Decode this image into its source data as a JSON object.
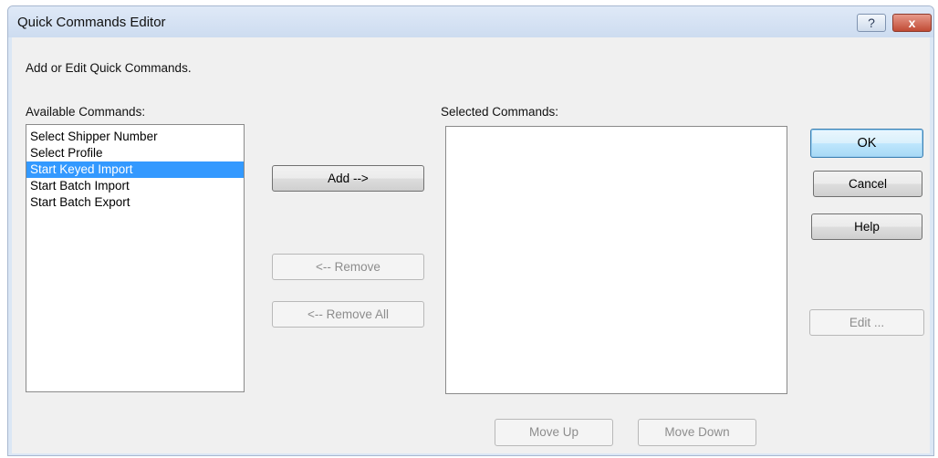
{
  "window": {
    "title": "Quick Commands Editor",
    "help_label": "?",
    "close_label": "x"
  },
  "instructions": "Add or Edit Quick Commands.",
  "available": {
    "label": "Available Commands:",
    "items": [
      "Select Shipper Number",
      "Select Profile",
      "Start Keyed Import",
      "Start Batch Import",
      "Start Batch Export"
    ],
    "selected_item": "Start Keyed Import"
  },
  "selected": {
    "label": "Selected Commands:",
    "items": []
  },
  "buttons": {
    "add": "Add -->",
    "remove": "<-- Remove",
    "remove_all": "<-- Remove All",
    "ok": "OK",
    "cancel": "Cancel",
    "help": "Help",
    "edit": "Edit ...",
    "move_up": "Move Up",
    "move_down": "Move Down"
  },
  "colors": {
    "selection": "#3399ff",
    "close_button": "#c14b35"
  }
}
